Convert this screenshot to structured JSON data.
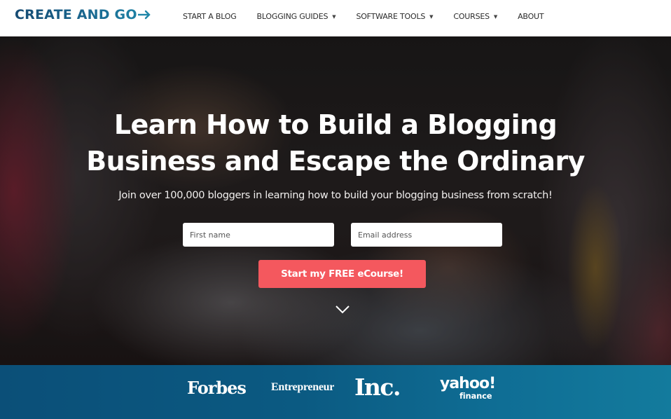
{
  "header": {
    "logo_text": "CREATE AND GO",
    "nav": [
      {
        "label": "START A BLOG",
        "has_dropdown": false
      },
      {
        "label": "BLOGGING GUIDES",
        "has_dropdown": true
      },
      {
        "label": "SOFTWARE TOOLS",
        "has_dropdown": true
      },
      {
        "label": "COURSES",
        "has_dropdown": true
      },
      {
        "label": "ABOUT",
        "has_dropdown": false
      }
    ],
    "dropdown_icon": "caret-down-icon"
  },
  "hero": {
    "headline_line1": "Learn How to Build a Blogging",
    "headline_line2": "Business and Escape the Ordinary",
    "subhead": "Join over 100,000 bloggers in learning how to build your blogging business from scratch!",
    "form": {
      "first_name_placeholder": "First name",
      "first_name_value": "",
      "email_placeholder": "Email address",
      "email_value": "",
      "submit_label": "Start my FREE eCourse!"
    },
    "scroll_icon": "chevron-down-icon",
    "colors": {
      "cta": "#f4585e",
      "text": "#ffffff"
    }
  },
  "press": {
    "logos": [
      {
        "name": "Forbes",
        "text": "Forbes"
      },
      {
        "name": "Entrepreneur",
        "text": "Entrepreneur"
      },
      {
        "name": "Inc",
        "text": "Inc."
      },
      {
        "name": "Yahoo Finance",
        "text": "yahoo!",
        "subtext": "finance"
      }
    ],
    "colors": {
      "banner_start": "#0b4f78",
      "banner_end": "#137b9d"
    }
  }
}
